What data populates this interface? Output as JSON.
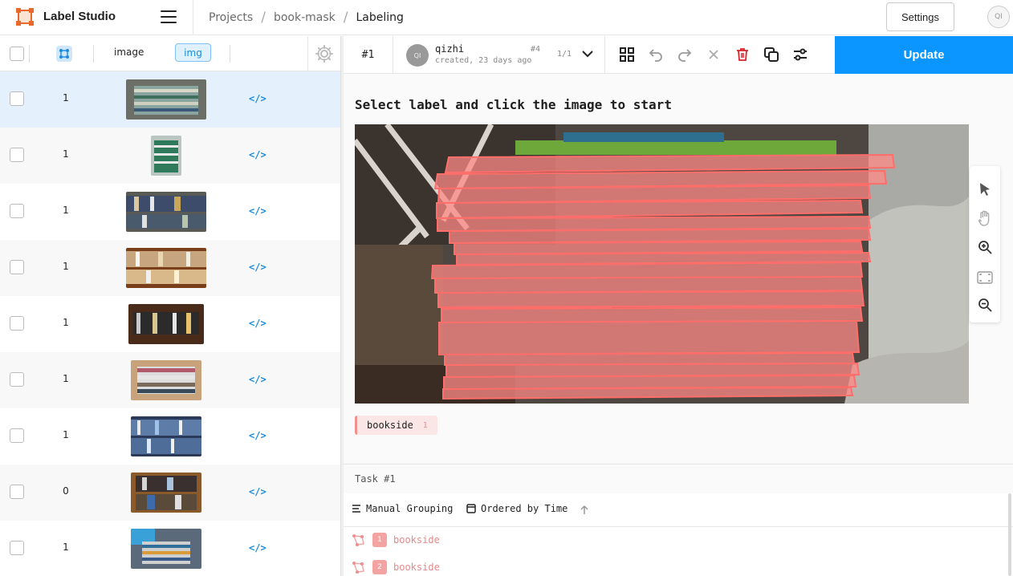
{
  "app": {
    "title": "Label Studio"
  },
  "breadcrumb": {
    "items": [
      "Projects",
      "book-mask",
      "Labeling"
    ],
    "separator": "/"
  },
  "header": {
    "settings_label": "Settings",
    "user_initials": "QI"
  },
  "table": {
    "columns": {
      "image": "image",
      "image_tag": "img"
    },
    "rows": [
      {
        "count": "1",
        "code": "</>",
        "selected": true
      },
      {
        "count": "1",
        "code": "</>"
      },
      {
        "count": "1",
        "code": "</>"
      },
      {
        "count": "1",
        "code": "</>"
      },
      {
        "count": "1",
        "code": "</>"
      },
      {
        "count": "1",
        "code": "</>"
      },
      {
        "count": "1",
        "code": "</>"
      },
      {
        "count": "0",
        "code": "</>"
      },
      {
        "count": "1",
        "code": "</>"
      }
    ]
  },
  "annotation": {
    "task_id": "#1",
    "user_initials": "QI",
    "user": "qizhi",
    "created": "created, 23 days ago",
    "number": "#4",
    "pager": "1/1",
    "update_label": "Update",
    "instruction": "Select label and click the image to start"
  },
  "labels": [
    {
      "name": "bookside",
      "hotkey": "1",
      "color": "#f28e8e"
    }
  ],
  "task_bar": {
    "text": "Task #1"
  },
  "regions": {
    "grouping_label": "Manual Grouping",
    "order_label": "Ordered by Time",
    "items": [
      {
        "index": "1",
        "label": "bookside"
      },
      {
        "index": "2",
        "label": "bookside"
      }
    ]
  },
  "colors": {
    "accent": "#0a95ff",
    "label": "#f28e8e",
    "selected_row": "#e4f0fc",
    "link": "#1a8ce0"
  }
}
